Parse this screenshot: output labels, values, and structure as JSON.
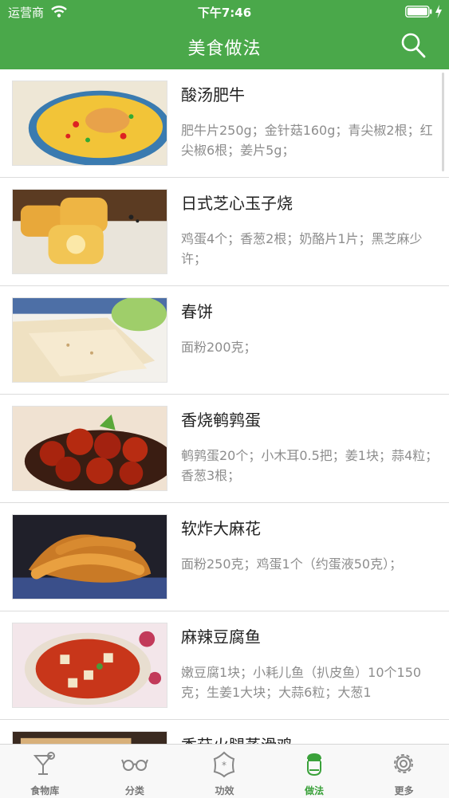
{
  "status_bar": {
    "carrier": "运营商",
    "time": "下午7:46"
  },
  "nav": {
    "title": "美食做法"
  },
  "recipes": [
    {
      "title": "酸汤肥牛",
      "ingredients": "肥牛片250g；金针菇160g；青尖椒2根；红尖椒6根；姜片5g；"
    },
    {
      "title": "日式芝心玉子烧",
      "ingredients": "鸡蛋4个；香葱2根；奶酪片1片；黑芝麻少许；"
    },
    {
      "title": "春饼",
      "ingredients": "面粉200克；"
    },
    {
      "title": "香烧鹌鹑蛋",
      "ingredients": "鹌鹑蛋20个；小木耳0.5把；姜1块；蒜4粒；香葱3根；"
    },
    {
      "title": "软炸大麻花",
      "ingredients": "面粉250克；鸡蛋1个（约蛋液50克）；"
    },
    {
      "title": "麻辣豆腐鱼",
      "ingredients": "嫩豆腐1块；小耗儿鱼（扒皮鱼）10个150克；生姜1大块；大蒜6粒；大葱1"
    },
    {
      "title": "香菇火腿蒸滑鸡",
      "ingredients": ""
    }
  ],
  "tabs": [
    {
      "label": "食物库",
      "icon": "cocktail-icon"
    },
    {
      "label": "分类",
      "icon": "glasses-icon"
    },
    {
      "label": "功效",
      "icon": "flower-icon"
    },
    {
      "label": "做法",
      "icon": "chef-icon"
    },
    {
      "label": "更多",
      "icon": "gear-icon"
    }
  ],
  "colors": {
    "brand": "#4aa84a",
    "active_tab": "#3aa13a",
    "inactive_tab": "#777777"
  }
}
